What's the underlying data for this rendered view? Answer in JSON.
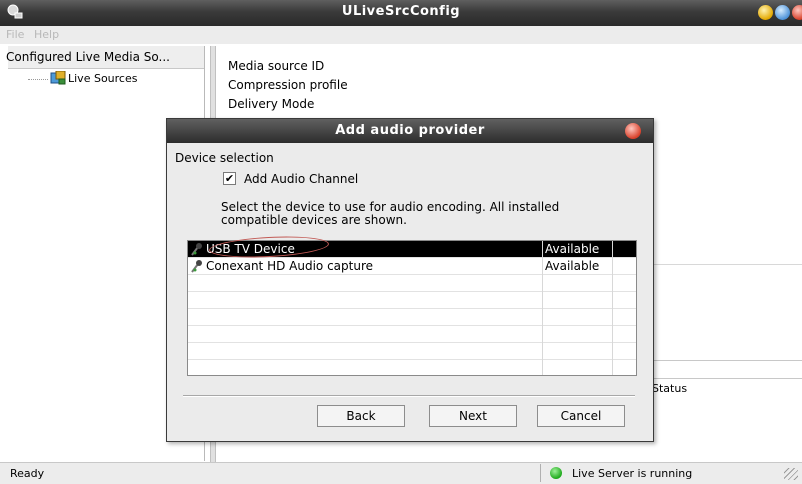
{
  "window": {
    "title": "ULiveSrcConfig"
  },
  "menu": [
    "File",
    "Help"
  ],
  "tree": {
    "header": "Configured Live Media So...",
    "items": [
      {
        "label": "Live Sources"
      }
    ]
  },
  "right_pane": {
    "labels": [
      "Media source ID",
      "Compression profile",
      "Delivery Mode"
    ],
    "status_column": "Status"
  },
  "statusbar": {
    "left": "Ready",
    "server": "Live Server is running"
  },
  "dialog": {
    "title": "Add audio provider",
    "section": "Device selection",
    "checkbox_label": "Add Audio Channel",
    "checkbox_checked": true,
    "description": "Select the device to use for audio encoding. All installed compatible devices are shown.",
    "devices": [
      {
        "name": "USB TV Device",
        "status": "Available",
        "selected": true
      },
      {
        "name": "Conexant HD Audio capture",
        "status": "Available",
        "selected": false
      }
    ],
    "buttons": {
      "back": "Back",
      "next": "Next",
      "cancel": "Cancel"
    }
  }
}
